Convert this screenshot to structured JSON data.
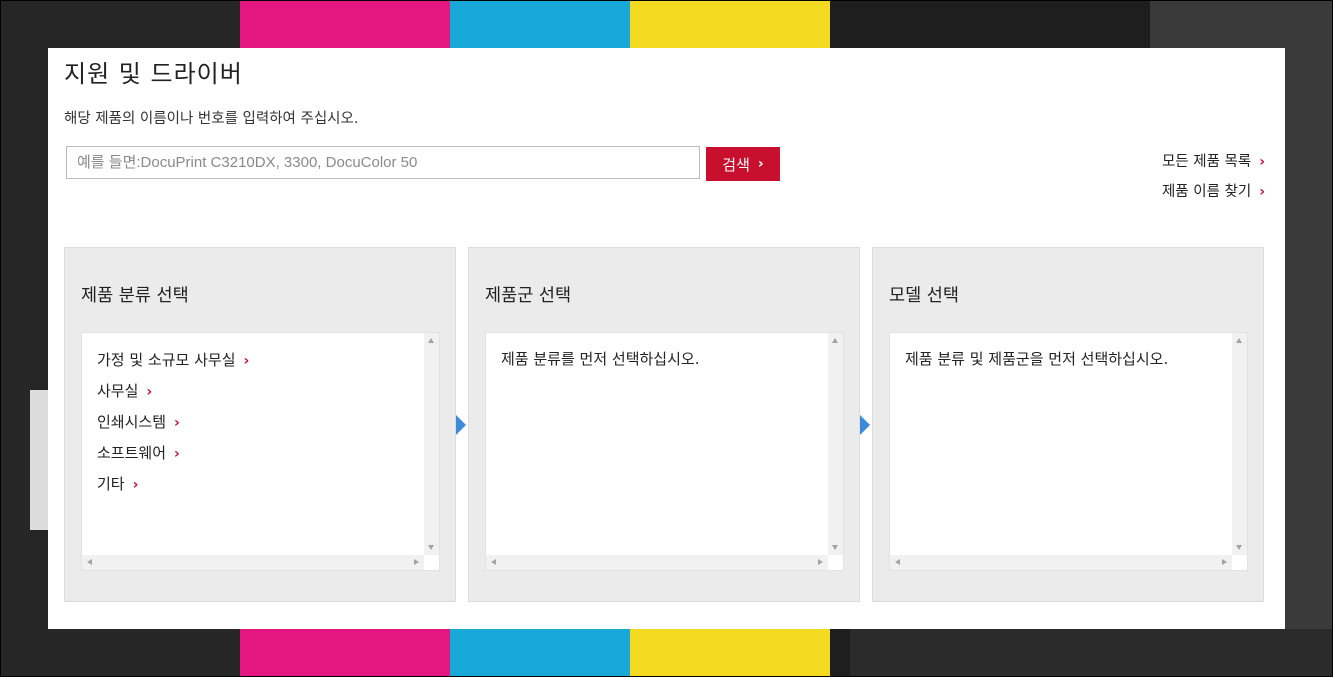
{
  "page": {
    "title": "지원 및 드라이버",
    "instruction": "해당 제품의 이름이나 번호를 입력하여 주십시오."
  },
  "search": {
    "placeholder": "예를 들면:DocuPrint C3210DX, 3300, DocuColor 50",
    "value": "",
    "button_label": "검색",
    "button_color": "#c8102e"
  },
  "side_links": [
    {
      "label": "모든 제품 목록"
    },
    {
      "label": "제품 이름 찾기"
    }
  ],
  "steps": {
    "category": {
      "title": "제품 분류 선택",
      "items": [
        {
          "label": "가정 및 소규모 사무실"
        },
        {
          "label": "사무실"
        },
        {
          "label": "인쇄시스템"
        },
        {
          "label": "소프트웨어"
        },
        {
          "label": "기타"
        }
      ]
    },
    "family": {
      "title": "제품군 선택",
      "message": "제품 분류를 먼저 선택하십시오."
    },
    "model": {
      "title": "모델 선택",
      "message": "제품 분류 및 제품군을 먼저 선택하십시오."
    }
  },
  "icons": {
    "chevron": "chevron-right-icon",
    "step_arrow": "arrow-right-icon",
    "step_arrow_color": "#3d8ad9"
  }
}
